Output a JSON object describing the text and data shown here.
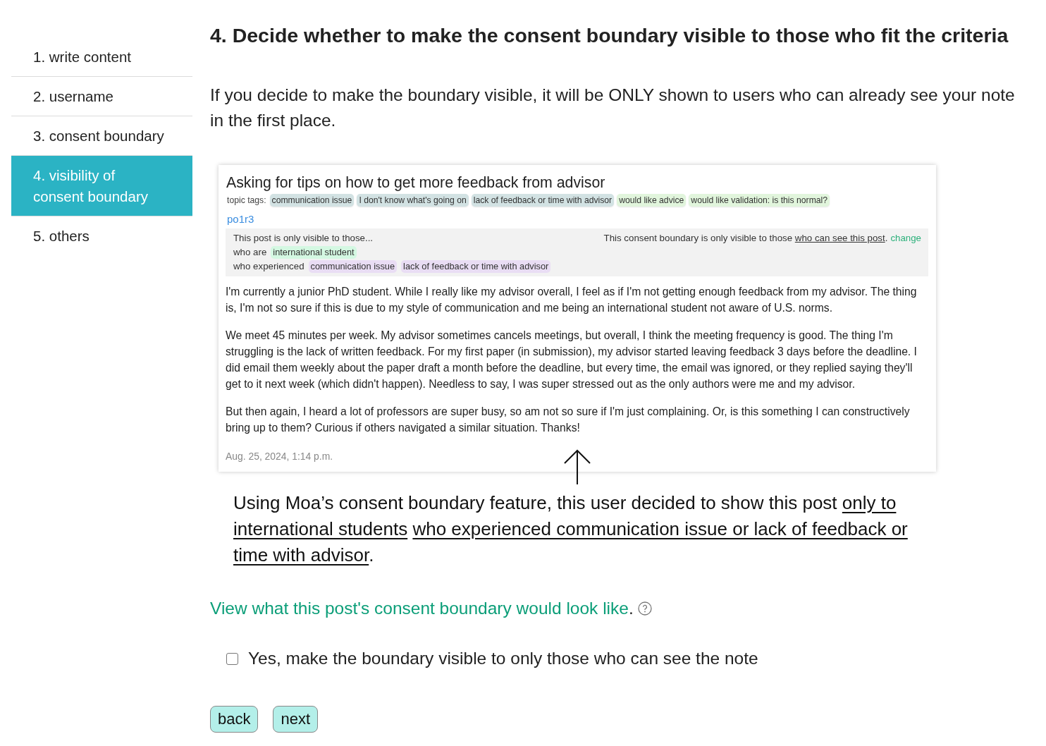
{
  "sidebar": {
    "items": [
      {
        "label": "1. write content",
        "selected": false
      },
      {
        "label": "2. username",
        "selected": false
      },
      {
        "label": "3. consent boundary",
        "selected": false
      },
      {
        "label": "4. visibility of consent boundary",
        "selected": true
      },
      {
        "label": "5. others",
        "selected": false
      }
    ]
  },
  "heading": "4. Decide whether to make the consent boundary visible to those who fit the criteria",
  "intro": "If you decide to make the boundary visible, it will be ONLY shown to users who can already see your note in the first place.",
  "example_post": {
    "title": "Asking for tips on how to get more feedback from advisor",
    "topic_tags_label": "topic tags:",
    "topic_tags": [
      {
        "label": "communication issue",
        "color": "#d2e2e3"
      },
      {
        "label": "I don't know what's going on",
        "color": "#d2e2e3"
      },
      {
        "label": "lack of feedback or time with advisor",
        "color": "#d2e2e3"
      },
      {
        "label": "would like advice",
        "color": "#e1f5dc"
      },
      {
        "label": "would like validation: is this normal?",
        "color": "#e1f5dc"
      }
    ],
    "username": "po1r3",
    "boundary": {
      "intro": "This post is only visible to those...",
      "note": {
        "before": "This consent boundary is only visible to those ",
        "link": "who can see this post",
        "after": "."
      },
      "action": "change",
      "criteria": [
        {
          "label": "who are",
          "tags": [
            {
              "label": "international student",
              "color": "#d4f8e2"
            }
          ]
        },
        {
          "label": "who experienced",
          "tags": [
            {
              "label": "communication issue",
              "color": "#e9ddf4"
            },
            {
              "label": "lack of feedback or time with advisor",
              "color": "#e9ddf4"
            }
          ]
        }
      ]
    },
    "paragraphs": [
      "I'm currently a junior PhD student. While I really like my advisor overall, I feel as if I'm not getting enough feedback from my advisor. The thing is, I'm not so sure if this is due to my style of communication and me being an international student not aware of U.S. norms.",
      "We meet 45 minutes per week. My advisor sometimes cancels meetings, but overall, I think the meeting frequency is good. The thing I'm struggling is the lack of written feedback. For my first paper (in submission), my advisor started leaving feedback 3 days before the deadline. I did email them weekly about the paper draft a month before the deadline, but every time, the email was ignored, or they replied saying they'll get to it next week (which didn't happen). Needless to say, I was super stressed out as the only authors were me and my advisor.",
      "But then again, I heard a lot of professors are super busy, so am not so sure if I'm just complaining. Or, is this something I can constructively bring up to them? Curious if others navigated a similar situation. Thanks!"
    ],
    "timestamp": "Aug. 25, 2024, 1:14 p.m."
  },
  "caption": [
    {
      "text": "Using Moa’s consent boundary feature, this user decided to show this post ",
      "underline": false
    },
    {
      "text": "only to international students ",
      "underline": true
    },
    {
      "text": "who experienced communication issue or lack of feedback or time with advisor",
      "underline": true
    },
    {
      "text": ".",
      "underline": false
    }
  ],
  "preview": {
    "link": "View what this post's consent boundary would look like",
    "after": "."
  },
  "checkbox": {
    "label": "Yes, make the boundary visible to only those who can see the note",
    "checked": false
  },
  "buttons": [
    {
      "label": "back"
    },
    {
      "label": "next"
    }
  ]
}
